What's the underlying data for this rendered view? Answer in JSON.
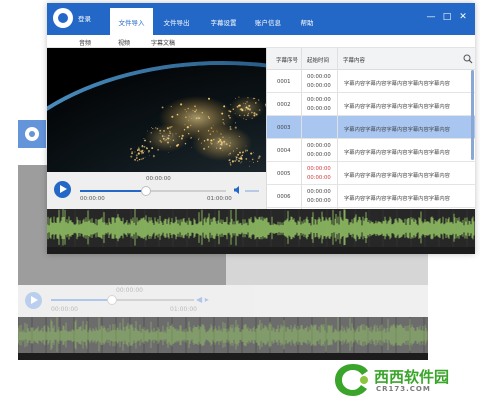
{
  "app": {
    "login_label": "登录",
    "menu": [
      {
        "label": "文件导入",
        "active": true
      },
      {
        "label": "文件导出",
        "active": false
      },
      {
        "label": "字幕设置",
        "active": false
      },
      {
        "label": "账户信息",
        "active": false
      },
      {
        "label": "帮助",
        "active": false
      }
    ],
    "window_buttons": {
      "minimize": "—",
      "maximize": "□",
      "close": "✕"
    },
    "accent_color": "#2468c7"
  },
  "subtabs": [
    "音频",
    "视频",
    "字幕文稿"
  ],
  "player": {
    "current_time": "00:00:00",
    "start_time": "00:00:00",
    "end_time": "01:00:00",
    "progress": 0.45
  },
  "subtitle_table": {
    "headers": [
      "字幕序号",
      "起始时间",
      "字幕内容"
    ],
    "rows": [
      {
        "index": "0001",
        "times": [
          "00:00:00",
          "00:00:00"
        ],
        "content": "字幕内容字幕内容字幕内容字幕内容字幕内容",
        "selected": false,
        "warning": false
      },
      {
        "index": "0002",
        "times": [
          "00:00:00",
          "00:00:00"
        ],
        "content": "字幕内容字幕内容字幕内容字幕内容字幕内容",
        "selected": false,
        "warning": false
      },
      {
        "index": "0003",
        "times": [
          "00:00:00",
          "00:00:00"
        ],
        "content": "字幕内容字幕内容字幕内容字幕内容字幕内容",
        "selected": true,
        "warning": false
      },
      {
        "index": "0004",
        "times": [
          "00:00:00",
          "00:00:00"
        ],
        "content": "字幕内容字幕内容字幕内容字幕内容字幕内容",
        "selected": false,
        "warning": false
      },
      {
        "index": "0005",
        "times": [
          "00:00:00",
          "00:00:00"
        ],
        "content": "字幕内容字幕内容字幕内容字幕内容字幕内容",
        "selected": false,
        "warning": true
      },
      {
        "index": "0006",
        "times": [
          "00:00:00",
          "00:00:00"
        ],
        "content": "字幕内容字幕内容字幕内容字幕内容字幕内容",
        "selected": false,
        "warning": false
      }
    ]
  },
  "back_window": {
    "current_time": "00:00:00",
    "start_time": "00:00:00",
    "end_time": "01:00:00"
  },
  "watermark": {
    "brand": "西西软件园",
    "domain": "CR173.COM"
  },
  "colors": {
    "selected_row": "#a9c6f1",
    "warning_time": "#d23a3a",
    "waveform": "#9bd06a",
    "brand_green": "#3aa52a"
  }
}
